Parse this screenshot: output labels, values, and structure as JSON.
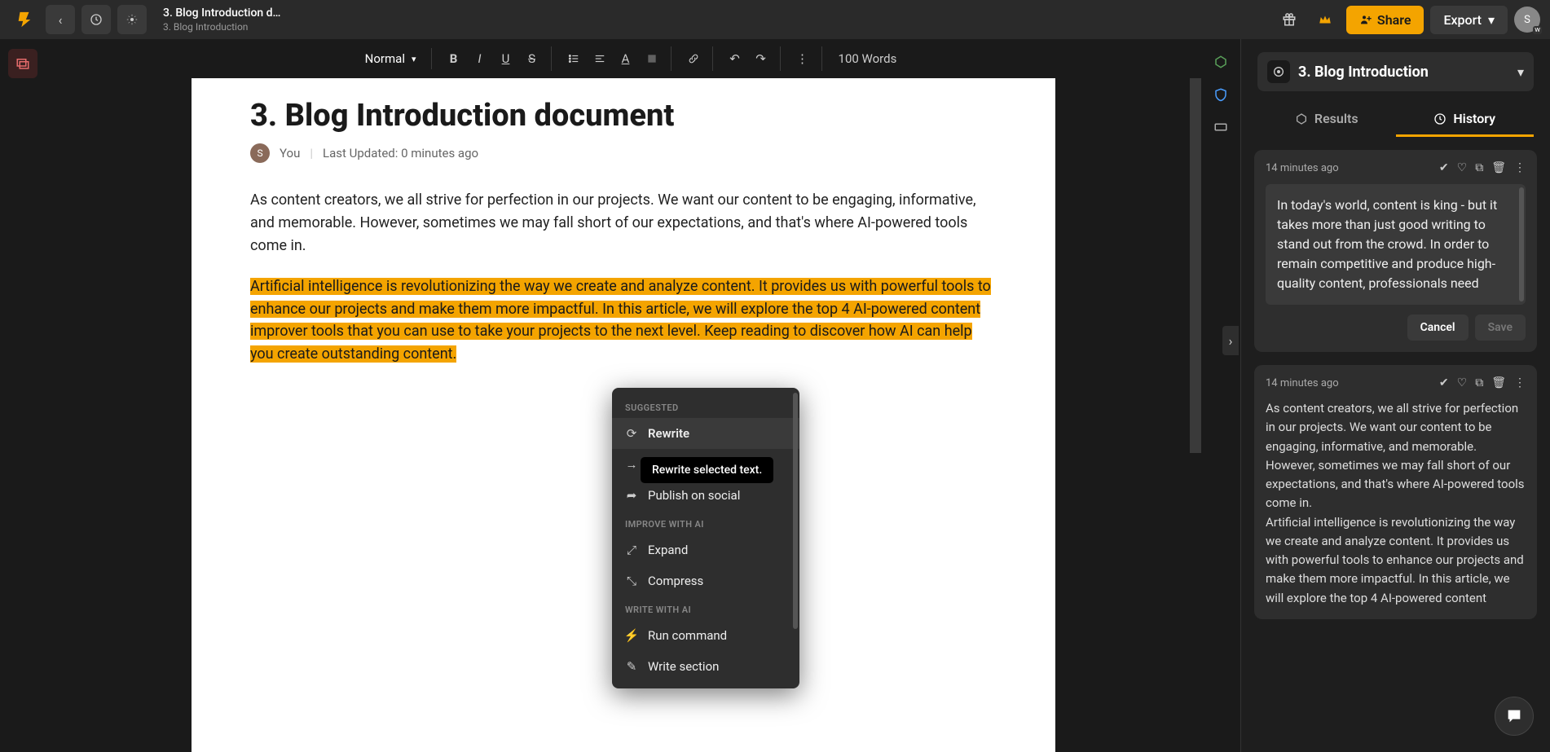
{
  "topbar": {
    "breadcrumb_title": "3. Blog Introduction d…",
    "breadcrumb_sub": "3. Blog Introduction",
    "share_label": "Share",
    "export_label": "Export",
    "avatar_letter": "S",
    "avatar_badge": "w"
  },
  "toolbar": {
    "style": "Normal",
    "word_count": "100 Words"
  },
  "document": {
    "title": "3. Blog Introduction document",
    "author_initial": "S",
    "author_label": "You",
    "last_updated": "Last Updated: 0 minutes ago",
    "para1": "As content creators, we all strive for perfection in our projects. We want our content to be engaging, informative, and memorable. However, sometimes we may fall short of our expectations, and that's where AI-powered tools come in.",
    "para2": "Artificial intelligence is revolutionizing the way we create and analyze content. It provides us with powerful tools to enhance our projects and make them more impactful. In this article, we will explore the top 4 AI-powered content improver tools that you can use to take your projects to the next level. Keep reading to discover how AI can help you create outstanding content."
  },
  "ctx": {
    "heading_suggested": "SUGGESTED",
    "rewrite": "Rewrite",
    "continue": "",
    "publish": "Publish on social",
    "heading_improve": "IMPROVE WITH AI",
    "expand": "Expand",
    "compress": "Compress",
    "heading_write": "WRITE WITH AI",
    "run_command": "Run command",
    "write_section": "Write section",
    "tooltip": "Rewrite selected text."
  },
  "panel": {
    "title": "3. Blog Introduction",
    "tab_results": "Results",
    "tab_history": "History",
    "cards": [
      {
        "time": "14 minutes ago",
        "text": "In today's world, content is king - but it takes more than just good writing to stand out from the crowd. In order to remain competitive and produce high-quality content, professionals need",
        "cancel": "Cancel",
        "save": "Save"
      },
      {
        "time": "14 minutes ago",
        "text": "As content creators, we all strive for perfection in our projects. We want our content to be engaging, informative, and memorable. However, sometimes we may fall short of our expectations, and that's where AI-powered tools come in.\nArtificial intelligence is revolutionizing the way we create and analyze content. It provides us with powerful tools to enhance our projects and make them more impactful. In this article, we will explore the top 4 AI-powered content"
      }
    ]
  }
}
